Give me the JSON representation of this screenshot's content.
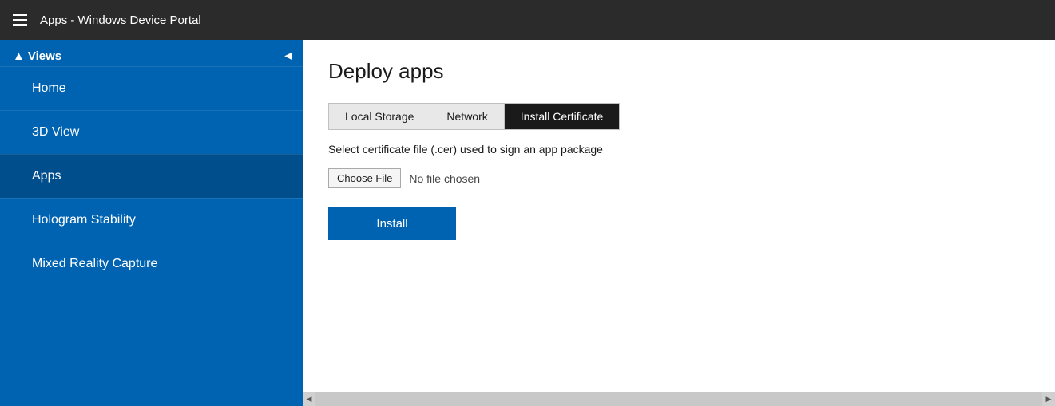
{
  "header": {
    "title": "Apps - Windows Device Portal",
    "menu_icon_label": "menu"
  },
  "sidebar": {
    "collapse_btn_label": "◄",
    "views_section_label": "Views",
    "views_arrow": "▲",
    "nav_items": [
      {
        "id": "home",
        "label": "Home",
        "active": false
      },
      {
        "id": "3d-view",
        "label": "3D View",
        "active": false
      },
      {
        "id": "apps",
        "label": "Apps",
        "active": true
      },
      {
        "id": "hologram-stability",
        "label": "Hologram Stability",
        "active": false
      },
      {
        "id": "mixed-reality-capture",
        "label": "Mixed Reality Capture",
        "active": false
      }
    ]
  },
  "content": {
    "page_title": "Deploy apps",
    "tabs": [
      {
        "id": "local-storage",
        "label": "Local Storage",
        "active": false
      },
      {
        "id": "network",
        "label": "Network",
        "active": false
      },
      {
        "id": "install-certificate",
        "label": "Install Certificate",
        "active": true
      }
    ],
    "certificate_description": "Select certificate file (.cer) used to sign an app package",
    "choose_file_label": "Choose File",
    "no_file_text": "No file chosen",
    "install_button_label": "Install"
  }
}
